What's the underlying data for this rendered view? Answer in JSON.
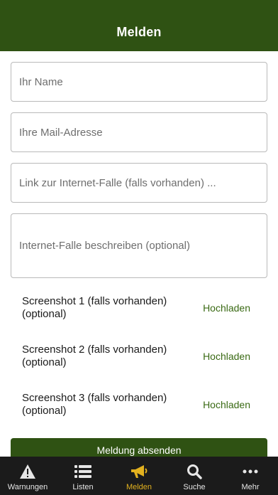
{
  "header": {
    "title": "Melden"
  },
  "form": {
    "name_placeholder": "Ihr Name",
    "mail_placeholder": "Ihre Mail-Adresse",
    "link_placeholder": "Link zur Internet-Falle (falls vorhanden) ...",
    "description_placeholder": "Internet-Falle beschreiben (optional)"
  },
  "screenshots": [
    {
      "label": "Screenshot 1 (falls vorhanden) (optional)",
      "action": "Hochladen"
    },
    {
      "label": "Screenshot 2 (falls vorhanden) (optional)",
      "action": "Hochladen"
    },
    {
      "label": "Screenshot 3 (falls vorhanden) (optional)",
      "action": "Hochladen"
    }
  ],
  "submit_label": "Meldung absenden",
  "tabs": [
    {
      "label": "Warnungen",
      "icon": "warning-icon"
    },
    {
      "label": "Listen",
      "icon": "list-icon"
    },
    {
      "label": "Melden",
      "icon": "megaphone-icon",
      "active": true
    },
    {
      "label": "Suche",
      "icon": "search-icon"
    },
    {
      "label": "Mehr",
      "icon": "more-icon"
    }
  ],
  "colors": {
    "primary": "#2f5213",
    "accent": "#e3b21f",
    "tabbar": "#1b1b1b",
    "link": "#3a6a14"
  }
}
